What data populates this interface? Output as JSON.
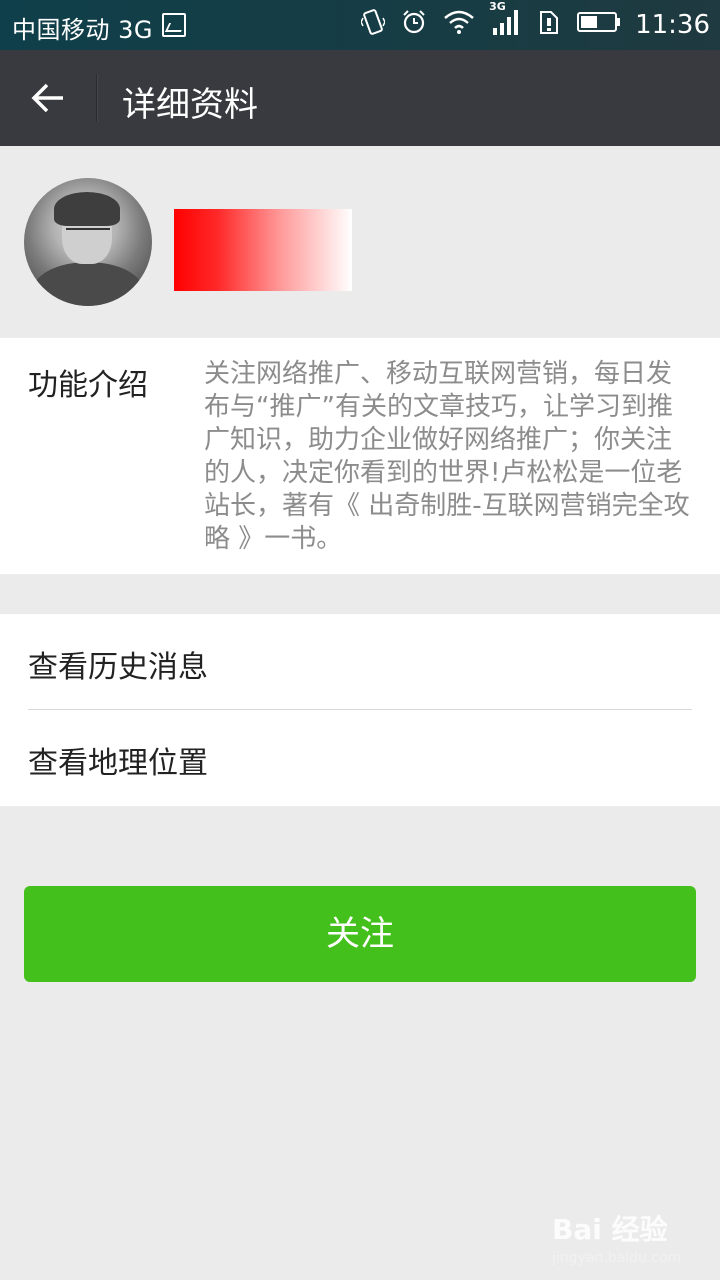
{
  "status_bar": {
    "carrier": "中国移动 3G",
    "network_small": "3G",
    "time": "11:36",
    "icons": [
      "image-icon",
      "vibrate-icon",
      "alarm-icon",
      "wifi-icon",
      "signal-icon",
      "sim-alert-icon",
      "battery-icon"
    ]
  },
  "navbar": {
    "title": "详细资料",
    "back_icon": "arrow-left-icon"
  },
  "profile": {
    "avatar": "avatar"
  },
  "intro": {
    "label": "功能介绍",
    "text": "关注网络推广、移动互联网营销，每日发布与“推广”有关的文章技巧，让学习到推广知识，助力企业做好网络推广；你关注的人，决定你看到的世界!卢松松是一位老站长，著有《 出奇制胜-互联网营销完全攻略 》一书。"
  },
  "menu": {
    "items": [
      {
        "label": "查看历史消息"
      },
      {
        "label": "查看地理位置"
      }
    ]
  },
  "actions": {
    "follow_label": "关注"
  },
  "watermark": {
    "logo": "Bai 经验",
    "url": "jingyan.baidu.com"
  },
  "colors": {
    "navbar": "#393a3f",
    "status_bar": "#173c44",
    "follow_button": "#44c01c",
    "page_background": "#ebebeb",
    "redaction": "#ff0000"
  }
}
